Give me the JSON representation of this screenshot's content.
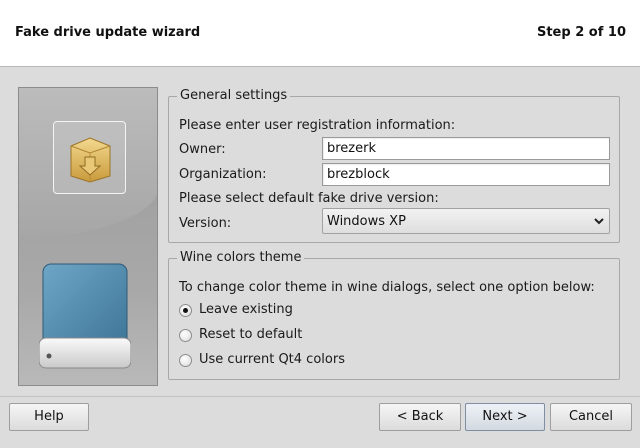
{
  "header": {
    "title": "Fake drive update wizard",
    "step": "Step 2 of 10"
  },
  "side_panel": {
    "package_icon": "package-download-icon",
    "drive_icon": "hard-drive-icon"
  },
  "general": {
    "legend": "General settings",
    "registration_prompt": "Please enter user registration information:",
    "owner_label": "Owner:",
    "owner_value": "brezerk",
    "organization_label": "Organization:",
    "organization_value": "brezblock",
    "version_prompt": "Please select default fake drive version:",
    "version_label": "Version:",
    "version_value": "Windows XP"
  },
  "theme": {
    "legend": "Wine colors theme",
    "prompt": "To change color theme in wine dialogs, select one option below:",
    "options": [
      {
        "label": "Leave existing",
        "checked": true
      },
      {
        "label": "Reset to default",
        "checked": false
      },
      {
        "label": "Use current Qt4 colors",
        "checked": false
      }
    ]
  },
  "buttons": {
    "help": "Help",
    "back": "< Back",
    "next": "Next >",
    "cancel": "Cancel"
  }
}
